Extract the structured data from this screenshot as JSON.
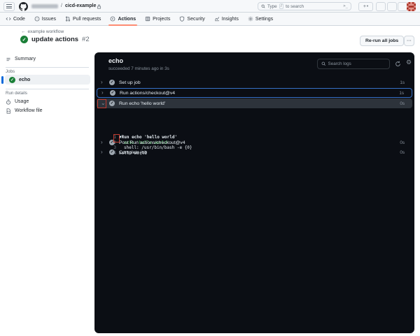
{
  "icons": {
    "command_palette": ">_",
    "kebab": "···",
    "plus": "+",
    "caret": "▾",
    "back_arrow": "←",
    "chevron_right": "›",
    "chevron_down": "⌄",
    "log_arrow": "▼",
    "check": "✓",
    "gear": "⚙"
  },
  "header": {
    "repo": "cicd-example",
    "separator": "/",
    "search_prefix": "Type",
    "search_key": "/",
    "search_suffix": "to search"
  },
  "nav": {
    "tabs": [
      {
        "label": "Code"
      },
      {
        "label": "Issues"
      },
      {
        "label": "Pull requests"
      },
      {
        "label": "Actions",
        "active": true
      },
      {
        "label": "Projects"
      },
      {
        "label": "Security"
      },
      {
        "label": "Insights"
      },
      {
        "label": "Settings"
      }
    ]
  },
  "run": {
    "breadcrumb": "example workflow",
    "title": "update actions",
    "number": "#2",
    "rerun_button": "Re-run all jobs"
  },
  "sidebar": {
    "summary_label": "Summary",
    "jobs_label": "Jobs",
    "job_echo": "echo",
    "run_details_label": "Run details",
    "usage_label": "Usage",
    "workflow_file_label": "Workflow file"
  },
  "panel": {
    "job_name": "echo",
    "status_line": "succeeded 7 minutes ago in 3s",
    "search_placeholder": "Search logs",
    "steps": [
      {
        "label": "Set up job",
        "duration": "1s"
      },
      {
        "label": "Run actions/checkout@v4",
        "duration": "1s",
        "focused": true
      },
      {
        "label": "Run echo 'hello world'",
        "duration": "0s",
        "expanded": true
      },
      {
        "label": "Post Run actions/checkout@v4",
        "duration": "0s"
      },
      {
        "label": "Complete job",
        "duration": "0s"
      }
    ],
    "log": [
      {
        "num": "1",
        "arrow": "▼",
        "text": "Run echo 'hello world'"
      },
      {
        "num": "2",
        "text": "echo 'hello world'"
      },
      {
        "num": "3",
        "text": "shell: /usr/bin/bash -e {0}"
      },
      {
        "num": "4",
        "text": "hello world"
      }
    ]
  },
  "colors": {
    "accent_orange": "#fd8c73",
    "accent_blue": "#0969da",
    "success_green": "#1a7f37",
    "log_green": "#3fb950",
    "annotation_red": "#c03a2e",
    "panel_bg": "#0b0e14"
  }
}
